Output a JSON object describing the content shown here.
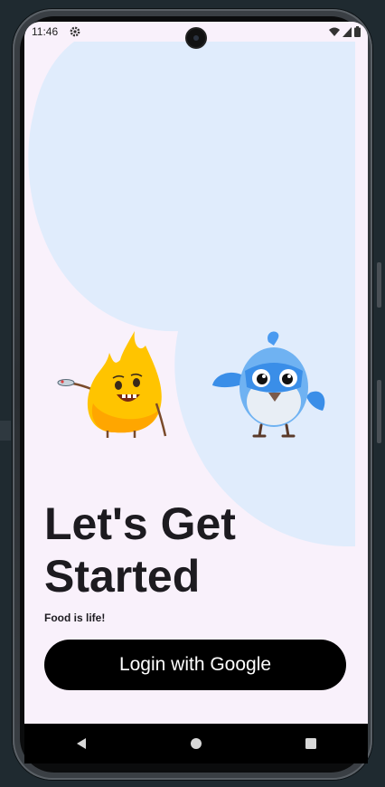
{
  "status_bar": {
    "time": "11:46",
    "icons": [
      "gear-icon",
      "wifi-icon",
      "signal-icon",
      "battery-icon"
    ]
  },
  "hero": {
    "mascots": [
      "fire-mascot",
      "bird-mascot"
    ],
    "blob_color": "#e0ecfc"
  },
  "content": {
    "headline_line1": "Let's Get",
    "headline_line2": "Started",
    "subtitle": "Food is life!",
    "login_button_label": "Login with Google"
  },
  "nav_bar": {
    "items": [
      "back-icon",
      "home-icon",
      "recents-icon"
    ]
  },
  "colors": {
    "background": "#f9f1fb",
    "button": "#000000",
    "text": "#1d1b20"
  }
}
